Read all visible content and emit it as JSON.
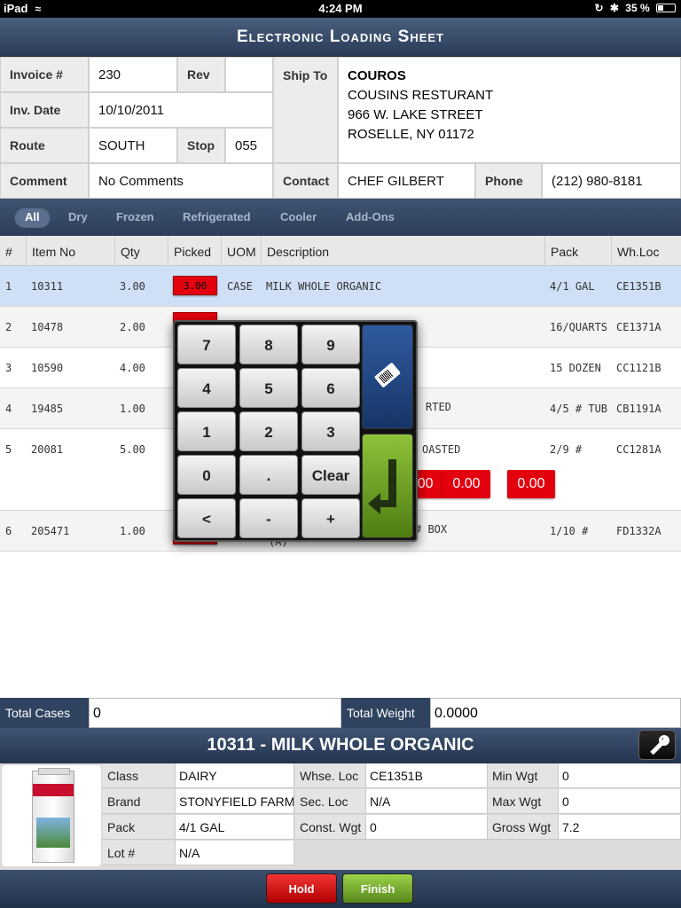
{
  "status_bar": {
    "device": "iPad",
    "time": "4:24 PM",
    "battery": "35 %"
  },
  "title": "Electronic Loading Sheet",
  "header": {
    "invoice_label": "Invoice #",
    "invoice": "230",
    "rev_label": "Rev",
    "rev": "",
    "inv_date_label": "Inv. Date",
    "inv_date": "10/10/2011",
    "route_label": "Route",
    "route": "SOUTH",
    "stop_label": "Stop",
    "stop": "055",
    "comment_label": "Comment",
    "comment": "No Comments",
    "ship_to_label": "Ship To",
    "ship_to": {
      "name": "COUROS",
      "line1": "COUSINS RESTURANT",
      "line2": "966 W. LAKE STREET",
      "line3": "ROSELLE, NY 01172"
    },
    "contact_label": "Contact",
    "contact": "CHEF GILBERT",
    "phone_label": "Phone",
    "phone": "(212) 980-8181"
  },
  "tabs": [
    "All",
    "Dry",
    "Frozen",
    "Refrigerated",
    "Cooler",
    "Add-Ons"
  ],
  "active_tab": "All",
  "grid": {
    "columns": [
      "#",
      "Item No",
      "Qty",
      "Picked",
      "UOM",
      "Description",
      "Pack",
      "Wh.Loc"
    ],
    "rows": [
      {
        "num": "1",
        "item_no": "10311",
        "qty": "3.00",
        "picked": "3.00",
        "uom": "CASE",
        "description": "MILK WHOLE ORGANIC",
        "pack": "4/1 GAL",
        "whloc": "CE1351B"
      },
      {
        "num": "2",
        "item_no": "10478",
        "qty": "2.00",
        "picked": "",
        "uom": "",
        "description": "",
        "pack": "16/QUARTS",
        "whloc": "CE1371A"
      },
      {
        "num": "3",
        "item_no": "10590",
        "qty": "4.00",
        "picked": "",
        "uom": "",
        "description": "",
        "pack": "15 DOZEN",
        "whloc": "CC1121B"
      },
      {
        "num": "4",
        "item_no": "19485",
        "qty": "1.00",
        "picked": "",
        "uom": "",
        "description": "RTED",
        "pack": "4/5 # TUB",
        "whloc": "CB1191A"
      },
      {
        "num": "5",
        "item_no": "20081",
        "qty": "5.00",
        "picked": "",
        "uom": "",
        "description": "OASTED",
        "pack": "2/9 #",
        "whloc": "CC1281A",
        "weights": [
          "0.00",
          "0.00",
          "0.00"
        ]
      },
      {
        "num": "6",
        "item_no": "205471",
        "qty": "1.00",
        "picked": "",
        "uom": "",
        "description": "# BOX",
        "description_sub": "(A)",
        "pack": "1/10 #",
        "whloc": "FD1332A"
      }
    ]
  },
  "keypad": {
    "keys": [
      [
        "7",
        "8",
        "9"
      ],
      [
        "4",
        "5",
        "6"
      ],
      [
        "1",
        "2",
        "3"
      ],
      [
        "0",
        ".",
        "Clear"
      ],
      [
        "<",
        "-",
        "+"
      ]
    ],
    "tag_icon": "price-tag-barcode-icon",
    "enter_icon": "enter-arrow-icon"
  },
  "totals": {
    "cases_label": "Total Cases",
    "cases": "0",
    "weight_label": "Total Weight",
    "weight": "0.0000"
  },
  "detail": {
    "title": "10311 - MILK WHOLE ORGANIC",
    "class_label": "Class",
    "class": "DAIRY",
    "brand_label": "Brand",
    "brand": "STONYFIELD FARM",
    "pack_label": "Pack",
    "pack": "4/1 GAL",
    "lot_label": "Lot #",
    "lot": "N/A",
    "whse_loc_label": "Whse. Loc",
    "whse_loc": "CE1351B",
    "sec_loc_label": "Sec. Loc",
    "sec_loc": "N/A",
    "const_wgt_label": "Const. Wgt",
    "const_wgt": "0",
    "min_wgt_label": "Min Wgt",
    "min_wgt": "0",
    "max_wgt_label": "Max Wgt",
    "max_wgt": "0",
    "gross_wgt_label": "Gross Wgt",
    "gross_wgt": "7.2",
    "product_image": "milk-carton-image"
  },
  "footer": {
    "hold_label": "Hold",
    "finish_label": "Finish"
  },
  "colors": {
    "picked_red": "#e3000f",
    "navy_bar": "#2f425f",
    "hold_red": "#d10000",
    "finish_green": "#6ea52a",
    "selected_row": "#cfe0f6"
  }
}
